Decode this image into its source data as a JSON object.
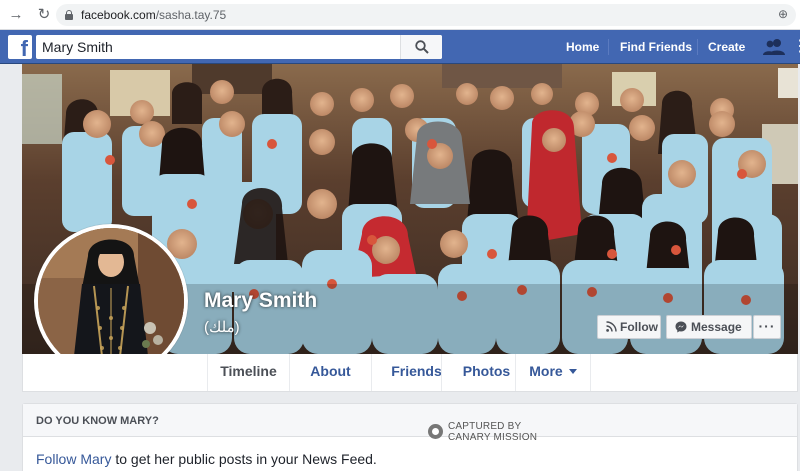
{
  "browser": {
    "url_host": "facebook.com",
    "url_path": "/sasha.tay.75"
  },
  "topbar": {
    "logo": "f",
    "search_value": "Mary Smith",
    "nav": [
      "Home",
      "Find Friends",
      "Create"
    ]
  },
  "profile": {
    "name": "Mary Smith",
    "alt_name": "(ملك)",
    "buttons": {
      "follow": "Follow",
      "message": "Message",
      "more": "···"
    }
  },
  "tabs": [
    "Timeline",
    "About",
    "Friends",
    "Photos",
    "More"
  ],
  "know_box": {
    "heading": "DO YOU KNOW MARY?",
    "link": "Follow Mary",
    "text": " to get her public posts in your News Feed."
  },
  "watermark": {
    "line1": "CAPTURED BY",
    "line2": "CANARY MISSION"
  },
  "colors": {
    "fb_blue": "#4267b2",
    "link_blue": "#365899",
    "shirt_blue": "#a8d4e6"
  }
}
